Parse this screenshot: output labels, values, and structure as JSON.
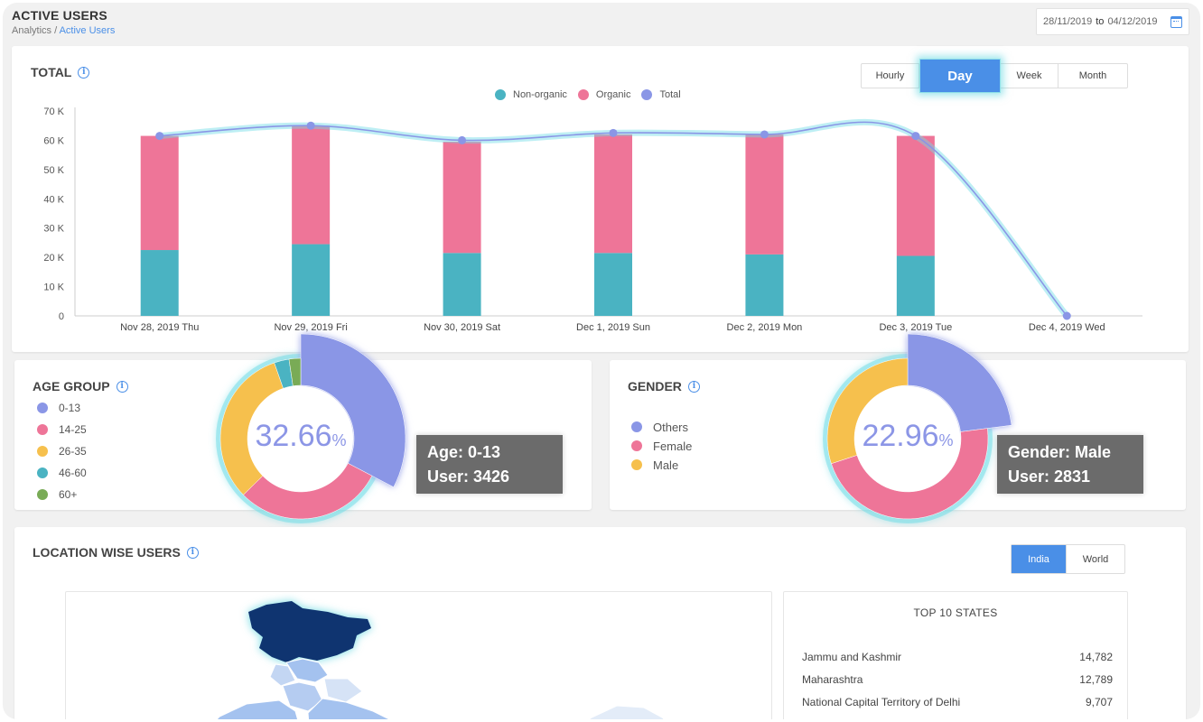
{
  "header": {
    "title": "ACTIVE USERS",
    "breadcrumb_root": "Analytics",
    "breadcrumb_sep": " / ",
    "breadcrumb_current": "Active Users",
    "date_from": "28/11/2019",
    "date_to_label": "to",
    "date_to": "04/12/2019"
  },
  "total": {
    "title": "TOTAL",
    "toggle": [
      "Hourly",
      "Day",
      "Week",
      "Month"
    ],
    "active_toggle": "Day"
  },
  "chart_data": {
    "type": "bar",
    "stacked": true,
    "categories": [
      "Nov 28, 2019 Thu",
      "Nov 29, 2019 Fri",
      "Nov 30, 2019 Sat",
      "Dec 1, 2019 Sun",
      "Dec 2, 2019 Mon",
      "Dec 3, 2019 Tue",
      "Dec 4, 2019 Wed"
    ],
    "series": [
      {
        "name": "Non-organic",
        "values": [
          22500,
          24500,
          21500,
          21500,
          21000,
          20500,
          0
        ],
        "color": "#4ab3c2"
      },
      {
        "name": "Organic",
        "values": [
          39000,
          40500,
          38000,
          40500,
          41000,
          41000,
          0
        ],
        "color": "#ee7598"
      },
      {
        "name": "Total",
        "kind": "line",
        "values": [
          61500,
          65000,
          60000,
          62500,
          62000,
          61500,
          0
        ],
        "color": "#8a96e6"
      }
    ],
    "ylim": [
      0,
      70000
    ],
    "yticks": [
      "0",
      "10 K",
      "20 K",
      "30 K",
      "40 K",
      "50 K",
      "60 K",
      "70 K"
    ],
    "legend_position": "top"
  },
  "age_group": {
    "title": "AGE GROUP",
    "items": [
      {
        "label": "0-13",
        "color": "#8a96e6"
      },
      {
        "label": "14-25",
        "color": "#ee7598"
      },
      {
        "label": "26-35",
        "color": "#f6c04d"
      },
      {
        "label": "46-60",
        "color": "#4ab3c2"
      },
      {
        "label": "60+",
        "color": "#79ab56"
      }
    ],
    "center_value": "32.66",
    "center_unit": "%",
    "tooltip_line1": "Age: 0-13",
    "tooltip_line2": "User: 3426",
    "slices": [
      32.66,
      30,
      32,
      3,
      2.34
    ]
  },
  "gender": {
    "title": "GENDER",
    "items": [
      {
        "label": "Others",
        "color": "#8a96e6"
      },
      {
        "label": "Female",
        "color": "#ee7598"
      },
      {
        "label": "Male",
        "color": "#f6c04d"
      }
    ],
    "center_value": "22.96",
    "center_unit": "%",
    "tooltip_line1": "Gender: Male",
    "tooltip_line2": "User: 2831",
    "slices": [
      22.96,
      47,
      30.04
    ]
  },
  "location": {
    "title": "LOCATION WISE USERS",
    "toggle": [
      "India",
      "World"
    ],
    "active_toggle": "India",
    "top_states_title": "TOP 10 STATES",
    "states": [
      {
        "name": "Jammu and Kashmir",
        "value": "14,782"
      },
      {
        "name": "Maharashtra",
        "value": "12,789"
      },
      {
        "name": "National Capital Territory of Delhi",
        "value": "9,707"
      }
    ]
  }
}
